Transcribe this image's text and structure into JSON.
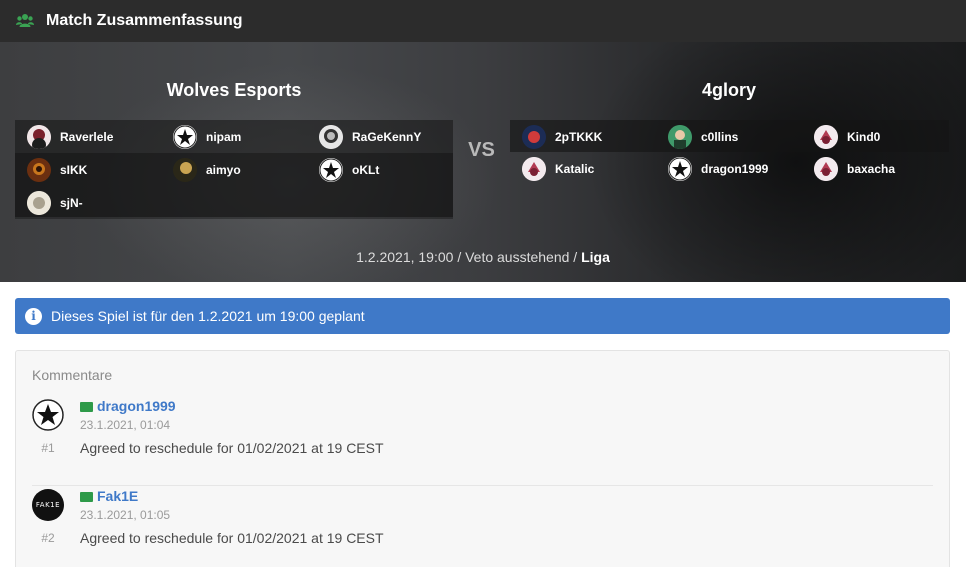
{
  "header": {
    "title": "Match Zusammenfassung",
    "icon": "users-icon",
    "icon_color": "#3aa353"
  },
  "match": {
    "team_a": {
      "name": "Wolves Esports",
      "players": [
        "Raverlele",
        "nipam",
        "RaGeKennY",
        "sIKK",
        "aimyo",
        "oKLt",
        "sjN-"
      ]
    },
    "team_b": {
      "name": "4glory",
      "players": [
        "2pTKKK",
        "c0llins",
        "Kind0",
        "Katalic",
        "dragon1999",
        "baxacha"
      ]
    },
    "vs_label": "VS",
    "meta_text": "1.2.2021, 19:00 / Veto ausstehend / ",
    "league": "Liga"
  },
  "alert": {
    "icon": "info-icon",
    "text": "Dieses Spiel ist für den 1.2.2021 um 19:00 geplant",
    "color": "#3f79c8"
  },
  "comments": {
    "title": "Kommentare",
    "items": [
      {
        "author": "dragon1999",
        "date": "23.1.2021, 01:04",
        "number": "#1",
        "text": "Agreed to reschedule for 01/02/2021 at 19 CEST"
      },
      {
        "author": "Fak1E",
        "date": "23.1.2021, 01:05",
        "number": "#2",
        "text": "Agreed to reschedule for 01/02/2021 at 19 CEST",
        "avatar_text": "FAK1E"
      }
    ]
  }
}
